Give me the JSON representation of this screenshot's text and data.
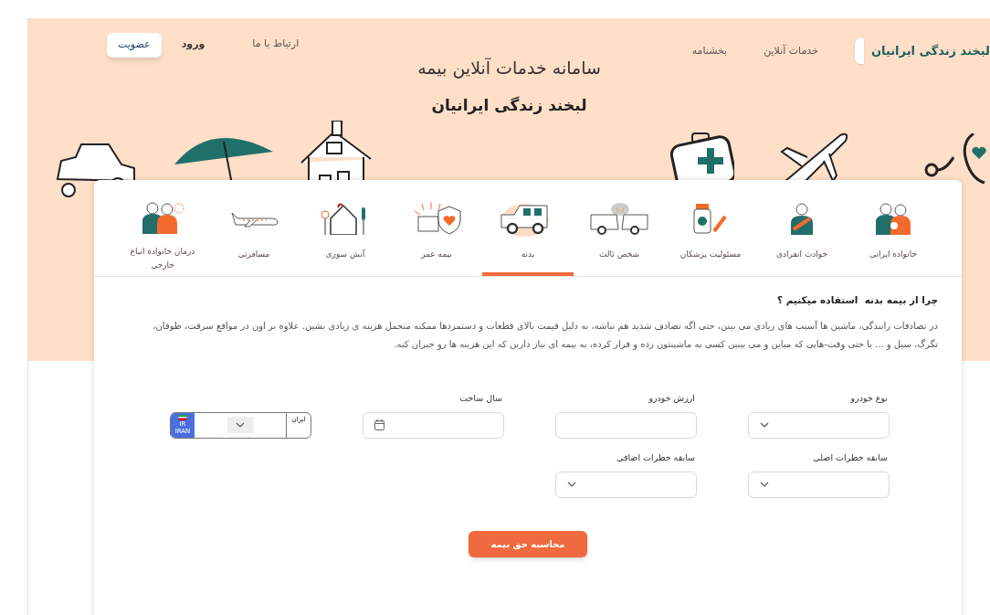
{
  "header": {
    "logo_text": "لبخند زندگی ایرانیان",
    "nav": [
      "خدمات آنلاین",
      "بخشنامه"
    ],
    "links": [
      "ارتباط با ما",
      "ورود"
    ],
    "signup_button": "عضویت"
  },
  "hero": {
    "title": "سامانه خدمات آنلاین بیمه",
    "subtitle": "لبخند زندگی ایرانیان"
  },
  "tabs": [
    {
      "label": "خانواده ایرانی",
      "selected": false
    },
    {
      "label": "حوادث انفرادی",
      "selected": false
    },
    {
      "label": "مسئولیت پزشکان",
      "selected": false
    },
    {
      "label": "شخص ثالث",
      "selected": false
    },
    {
      "label": "بدنه",
      "selected": true
    },
    {
      "label": "بیمه عمر",
      "selected": false
    },
    {
      "label": "آتش سوزی",
      "selected": false
    },
    {
      "label": "مسافرتی",
      "selected": false
    },
    {
      "label": "درمان خانواده اتباع خارجی",
      "selected": false
    }
  ],
  "intro": {
    "heading": "چرا از بیمه بدنه  استفاده میکنیم ؟",
    "paragraph": "در تصادفات رانندگی، ماشین ها آسیب های زیادی می بینن، حتی اگه تصادف شدید هم نباشه، به دلیل قیمت بالای قطعات و دستمزدها ممکنه متحمل هزینه ی زیادی بشین. علاوه بر اون در مواقع سرقت، طوفان، تگرگ، سیل و ... یا حتی وقت-هایی که میاین و می بینین کسی به ماشینتون زده و فرار کرده، به بیمه ای نیاز دارین که این هزینه ها رو جبران کنه."
  },
  "form": {
    "rows": [
      [
        {
          "label": "نوع خودرو",
          "kind": "select"
        },
        {
          "label": "ارزش خودرو",
          "kind": "text"
        },
        {
          "label": "سال ساخت",
          "kind": "date"
        },
        {
          "kind": "plate",
          "province": "ایران",
          "country_code": "IR",
          "country_name": "IRAN"
        }
      ],
      [
        {
          "label": "سابقه خطرات اصلی",
          "kind": "select"
        },
        {
          "label": "سابقه خطرات اضافی",
          "kind": "select"
        }
      ]
    ]
  },
  "submit_button": "محاسبه حق بیمه"
}
